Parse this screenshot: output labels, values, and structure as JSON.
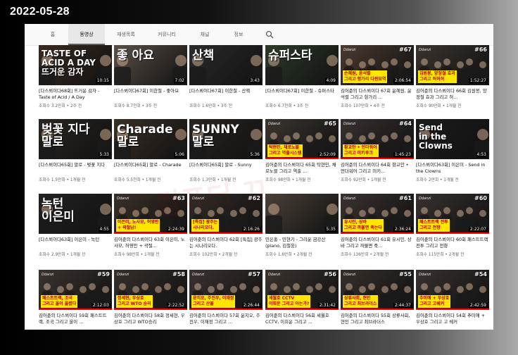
{
  "date_stamp": "2022-05-28",
  "tabs": [
    {
      "label": "홈",
      "active": false
    },
    {
      "label": "동영상",
      "active": true
    },
    {
      "label": "재생목록",
      "active": false
    },
    {
      "label": "커뮤니티",
      "active": false
    },
    {
      "label": "채널",
      "active": false
    },
    {
      "label": "정보",
      "active": false
    }
  ],
  "watermark": "컴퓨터 끄",
  "videos": [
    {
      "title": "[다스뵈이다68회] 뜨거운 감자 - Taste of Acid / A Day",
      "meta": "조회수 3.2만회 • 2주 전",
      "duration": "10:15",
      "overlay": "TASTE OF\nACID A DAY\n뜨거운 감자",
      "bg": "#3a2a20",
      "progress": 0
    },
    {
      "title": "[다스뵈이다67회] 이한철 - 좋아요",
      "meta": "조회수 8.7천회 • 3주 전",
      "duration": "7:02",
      "overlay": "좋 아요",
      "bg": "#5a5048",
      "progress": 0
    },
    {
      "title": "[다스뵈이다67회] 이한철 - 산책",
      "meta": "조회수 1.6만회 • 3주 전",
      "duration": "3:43",
      "overlay": "산책",
      "bg": "#2b2b2b",
      "progress": 0
    },
    {
      "title": "[다스뵈이다67회] 이한철 - 슈퍼스타",
      "meta": "조회수 6.7천회 • 3주 전",
      "duration": "4:09",
      "overlay": "슈퍼스타",
      "bg": "#2d3a2a",
      "progress": 0
    },
    {
      "title": "김어준의 다스뵈이다 67회 윤혜원, 윤석렬 그리고 헝가리 ...",
      "meta": "조회수 107만회 • 4주 전",
      "duration": "2:06:54",
      "overlay": "손혜원, 윤석렬\n그리고 헝가리 다윈묘역",
      "bg": "#4a3a30",
      "progress": 0,
      "num": "#67"
    },
    {
      "title": "김어준의 다스뵈이다 66회 김원봉, 양정철 효과 그리고 허...",
      "meta": "조회수 90만회 • 1개월 전",
      "duration": "1:52:27",
      "overlay": "김원봉, 양정철 효과\n그리고 허허허",
      "bg": "#3a3430",
      "progress": 0,
      "num": "#66"
    },
    {
      "title": "[다스뵈이다65회] 말로 - 벚꽃 지다",
      "meta": "조회수 1.5만회 • 1개월 전",
      "duration": "5:33",
      "overlay": "벚꽃 지다\n말로",
      "bg": "#2a2622",
      "progress": 0
    },
    {
      "title": "[다스뵈이다65회] 말로 - Charade",
      "meta": "조회수 5.5천회 • 1개월 전",
      "duration": "5:06",
      "overlay": "Charade\n말로",
      "bg": "#3a3026",
      "progress": 0
    },
    {
      "title": "[다스뵈이다65회] 말로 - Sunny",
      "meta": "조회수 1.3만회 • 1개월 전",
      "duration": "5:36",
      "overlay": "SUNNY\n말로",
      "bg": "#2a2522",
      "progress": 0
    },
    {
      "title": "김어준의 다스뵈이다 65회 탁현민, 채로노블 그리고 역출 ...",
      "meta": "조회수 98만회 • 1개월 전",
      "duration": "2:52:09",
      "overlay": "탁현민, 채로노블\n그리고 역출시스템",
      "bg": "#3a3530",
      "progress": 100,
      "num": "#65"
    },
    {
      "title": "김어준의 다스뵈이다 64회 항교안 • 언더워어 그리고 미키...",
      "meta": "조회수 92만회 • 1개월 전",
      "duration": "1:45:23",
      "overlay": "황교안 • 언더워어\n그리고 미키루크",
      "bg": "#383030",
      "progress": 100,
      "num": "#64"
    },
    {
      "title": "[다스뵈이다63회] 이은미 - Send in the Clowns",
      "meta": "조회수 2만회 • 1개월 전",
      "duration": "4:53",
      "overlay": "Send\nin the\nClowns",
      "bg": "#1c1c1c",
      "progress": 0
    },
    {
      "title": "[다스뵈이다63회] 이은미 - 녹턴",
      "meta": "조회수 2.9만회 • 1개월 전",
      "duration": "4:55",
      "overlay": "녹턴\n이은미",
      "bg": "#222222",
      "progress": 0
    },
    {
      "title": "김어준의 다스뵈이다 63회 이은미, 노사모, 허영만 + 곽철...",
      "meta": "조회수 98만회 • 1개월 전",
      "duration": "2:24:39",
      "overlay": "이은미, 노사모, 허영만\n+ 곽철남!",
      "bg": "#3a3028",
      "progress": 100,
      "num": "#63"
    },
    {
      "title": "김어준의 다스뵈이다 62회 [특집] 광주는 시나리오다.",
      "meta": "조회수 102만회 • 2개월 전",
      "duration": "2:16:26",
      "overlay": "[특집] 광주는\n시나리오다.",
      "bg": "#302c28",
      "progress": 100,
      "num": "#62"
    },
    {
      "title": "민은홍 - 민현기 - 그리운 금강산 (piano, 김철웅)",
      "meta": "조회수 1.6만회 • 2개월 전",
      "duration": "5:35",
      "overlay": "",
      "bg": "#4a4038",
      "progress": 0
    },
    {
      "title": "김어준의 다스뵈이다 61회 유시민, 상바 그리고 까불면 죽...",
      "meta": "조회수 136만회 • 2개월 전",
      "duration": "2:36:24",
      "overlay": "유시민, 상바\n그리고 까불면 죽는다",
      "bg": "#3a3230",
      "progress": 100,
      "num": "#61"
    },
    {
      "title": "김어준의 다스뵈이다 60회 패스트트랙 전투 그리고 전향",
      "meta": "조회수 115만회 • 2개월 전",
      "duration": "2:22:07",
      "overlay": "패스트트랙 전투\n그리고 전향",
      "bg": "#383230",
      "progress": 100,
      "num": "#60"
    },
    {
      "title": "김어준의 다스뵈이다 59회 패스트트랙, 조국 그리고 올이 ...",
      "meta": "",
      "duration": "2:12:03",
      "overlay": "패스트트랙, 조국\n그리고 올이 풀렸다",
      "bg": "#3a3430",
      "progress": 100,
      "num": "#59"
    },
    {
      "title": "김어준의 다스뵈이다 58회 정세현, 우상호 그리고 WTO승리",
      "meta": "",
      "duration": "2:22:52",
      "overlay": "정세현, 우상호\n그리고 WTO 승리",
      "bg": "#36302c",
      "progress": 100,
      "num": "#58"
    },
    {
      "title": "김어준의 다스뵈이다 57회 윤지오, 주진우, 이재정 그리고 ...",
      "meta": "",
      "duration": "2:26:44",
      "overlay": "윤지오, 주진우, 이재정\n그리고 산불",
      "bg": "#3a3230",
      "progress": 100,
      "num": "#57"
    },
    {
      "title": "김어준의 다스뵈이다 56회 세월호 CCTV, 이희운 그리고 ...",
      "meta": "",
      "duration": "2:31:42",
      "overlay": "세월호 CCTV\n이희운 그리고 아는가?",
      "bg": "#3a3430",
      "progress": 100,
      "num": "#56"
    },
    {
      "title": "김어준의 다스뵈이다 55회 상류사회, 현인 그리고 최브라더스",
      "meta": "",
      "duration": "2:44:37",
      "overlay": "상류사회, 현인\n그리고 최브라더스",
      "bg": "#36302c",
      "progress": 100,
      "num": "#55"
    },
    {
      "title": "김어준의 다스뵈이다 54회 추미애 + 우상호 그리고 고 쉐커",
      "meta": "",
      "duration": "2:42:59",
      "overlay": "추미애 + 우상호\n그리고 고쉐커",
      "bg": "#383230",
      "progress": 100,
      "num": "#54"
    }
  ]
}
